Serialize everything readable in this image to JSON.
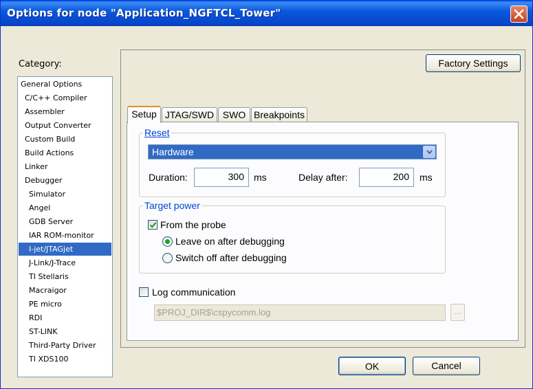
{
  "window": {
    "title": "Options for node \"Application_NGFTCL_Tower\""
  },
  "category": {
    "label": "Category:",
    "items": [
      {
        "label": "General Options",
        "indent": 0
      },
      {
        "label": "C/C++ Compiler",
        "indent": 1
      },
      {
        "label": "Assembler",
        "indent": 1
      },
      {
        "label": "Output Converter",
        "indent": 1
      },
      {
        "label": "Custom Build",
        "indent": 1
      },
      {
        "label": "Build Actions",
        "indent": 1
      },
      {
        "label": "Linker",
        "indent": 1
      },
      {
        "label": "Debugger",
        "indent": 1
      },
      {
        "label": "Simulator",
        "indent": 2
      },
      {
        "label": "Angel",
        "indent": 2
      },
      {
        "label": "GDB Server",
        "indent": 2
      },
      {
        "label": "IAR ROM-monitor",
        "indent": 2
      },
      {
        "label": "I-jet/JTAGjet",
        "indent": 2,
        "selected": true
      },
      {
        "label": "J-Link/J-Trace",
        "indent": 2
      },
      {
        "label": "TI Stellaris",
        "indent": 2
      },
      {
        "label": "Macraigor",
        "indent": 2
      },
      {
        "label": "PE micro",
        "indent": 2
      },
      {
        "label": "RDI",
        "indent": 2
      },
      {
        "label": "ST-LINK",
        "indent": 2
      },
      {
        "label": "Third-Party Driver",
        "indent": 2
      },
      {
        "label": "TI XDS100",
        "indent": 2
      }
    ]
  },
  "factory_settings_label": "Factory Settings",
  "tabs": [
    {
      "label": "Setup",
      "active": true
    },
    {
      "label": "JTAG/SWD",
      "active": false
    },
    {
      "label": "SWO",
      "active": false
    },
    {
      "label": "Breakpoints",
      "active": false
    }
  ],
  "reset": {
    "group_label": "Reset",
    "selected": "Hardware",
    "duration_label": "Duration:",
    "duration_value": "300",
    "duration_unit": "ms",
    "delay_label": "Delay after:",
    "delay_value": "200",
    "delay_unit": "ms"
  },
  "target_power": {
    "group_label": "Target power",
    "from_probe_label": "From the probe",
    "from_probe_checked": true,
    "leave_on_label": "Leave on after debugging",
    "switch_off_label": "Switch off after debugging",
    "selected_option": "leave_on"
  },
  "log": {
    "label": "Log communication",
    "checked": false,
    "path": "$PROJ_DIR$\\cspycomm.log",
    "browse_label": "..."
  },
  "buttons": {
    "ok_label": "OK",
    "cancel_label": "Cancel"
  },
  "colors": {
    "title_bar": "#0a5fe8",
    "selection": "#316ac5",
    "group_title": "#0046d5",
    "radio_selected": "#21a121"
  }
}
